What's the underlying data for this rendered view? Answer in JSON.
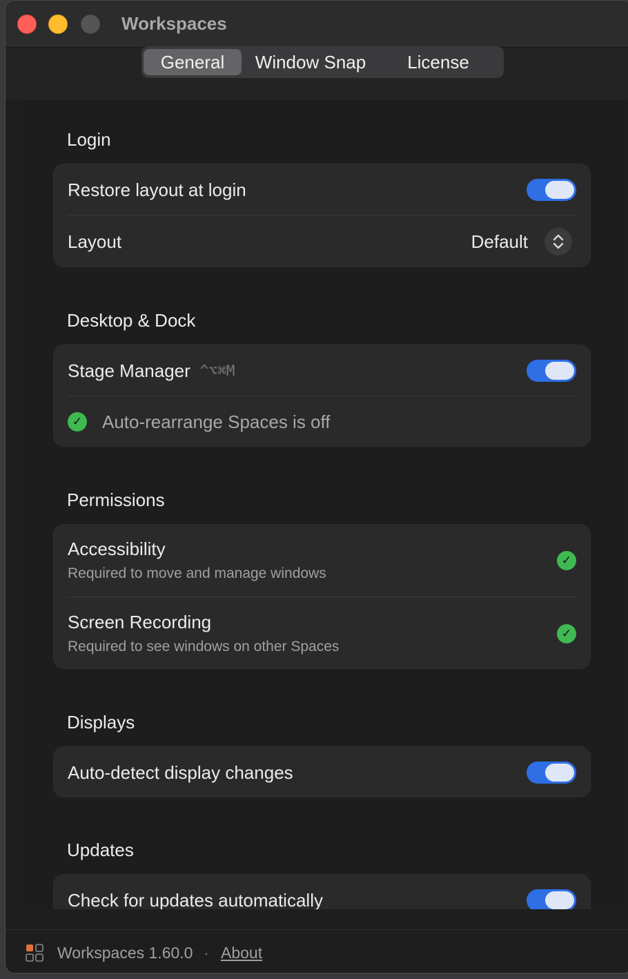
{
  "window": {
    "title": "Workspaces"
  },
  "tabs": [
    {
      "label": "General",
      "selected": true
    },
    {
      "label": "Window Snap",
      "selected": false
    },
    {
      "label": "License",
      "selected": false
    }
  ],
  "sections": {
    "login": {
      "title": "Login",
      "restore": {
        "label": "Restore layout at login",
        "enabled": true
      },
      "layout": {
        "label": "Layout",
        "value": "Default"
      }
    },
    "desktop": {
      "title": "Desktop & Dock",
      "stage": {
        "label": "Stage Manager",
        "shortcut": "^⌥⌘M",
        "enabled": true
      },
      "status": {
        "text": "Auto-rearrange Spaces is off",
        "ok": true
      }
    },
    "permissions": {
      "title": "Permissions",
      "accessibility": {
        "label": "Accessibility",
        "sub": "Required to move and manage windows",
        "granted": true
      },
      "screen": {
        "label": "Screen Recording",
        "sub": "Required to see windows on other Spaces",
        "granted": true
      }
    },
    "displays": {
      "title": "Displays",
      "autodetect": {
        "label": "Auto-detect display changes",
        "enabled": true
      }
    },
    "updates": {
      "title": "Updates",
      "auto": {
        "label": "Check for updates automatically",
        "enabled": true
      }
    }
  },
  "footer": {
    "version": "Workspaces 1.60.0",
    "separator": "·",
    "about": "About"
  },
  "colors": {
    "accent": "#2e6fe6",
    "success": "#3fb952"
  }
}
